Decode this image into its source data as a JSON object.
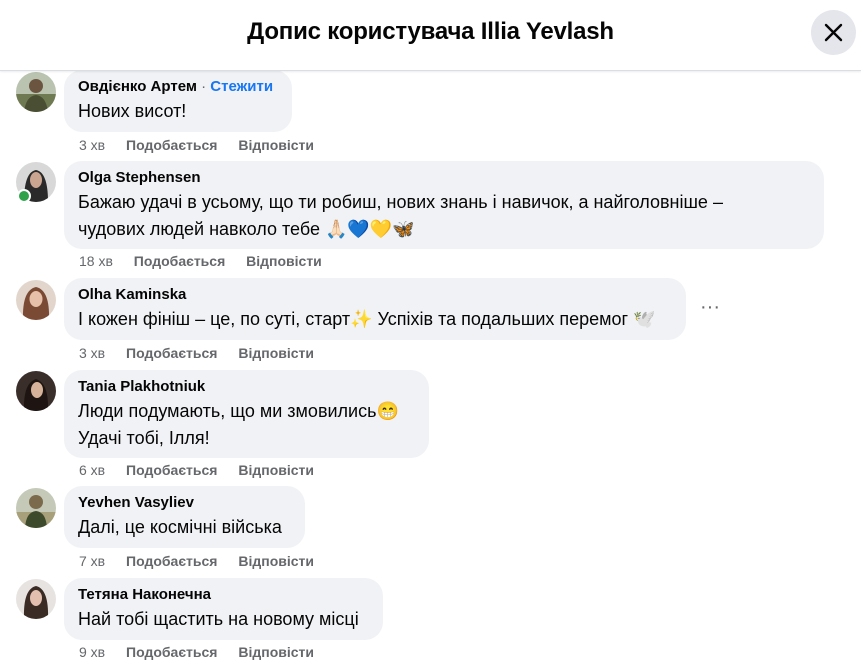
{
  "header": {
    "title": "Допис користувача Illia Yevlash"
  },
  "comments": [
    {
      "author": "Овдієнко Артем",
      "follow": "Стежити",
      "sep": "·",
      "lines": [
        "Нових висот!"
      ],
      "time": "3 хв",
      "like": "Подобається",
      "reply": "Відповісти"
    },
    {
      "author": "Olga Stephensen",
      "lines": [
        "Бажаю удачі в усьому, що ти робиш, нових знань і навичок, а найголовніше –",
        "чудових людей навколо тебе 🙏🏻💙💛🦋"
      ],
      "time": "18 хв",
      "like": "Подобається",
      "reply": "Відповісти"
    },
    {
      "author": "Olha Kaminska",
      "lines": [
        "І кожен фініш – це, по суті, старт✨ Успіхів та подальших перемог 🕊️"
      ],
      "time": "3 хв",
      "like": "Подобається",
      "reply": "Відповісти"
    },
    {
      "author": "Tania Plakhotniuk",
      "lines": [
        "Люди подумають, що ми змовились😁",
        "Удачі тобі, Ілля!"
      ],
      "time": "6 хв",
      "like": "Подобається",
      "reply": "Відповісти"
    },
    {
      "author": "Yevhen Vasyliev",
      "lines": [
        "Далі, це космічні війська"
      ],
      "time": "7 хв",
      "like": "Подобається",
      "reply": "Відповісти"
    },
    {
      "author": "Тетяна Наконечна",
      "lines": [
        "Най тобі щастить на новому місці"
      ],
      "time": "9 хв",
      "like": "Подобається",
      "reply": "Відповісти"
    }
  ],
  "more_options": "···",
  "colors": {
    "bubble": "#f0f2f5",
    "link": "#1877f2",
    "meta": "#65676b",
    "online": "#31a24c"
  },
  "icons": [
    "close-icon",
    "more-options-icon",
    "online-status-icon"
  ]
}
